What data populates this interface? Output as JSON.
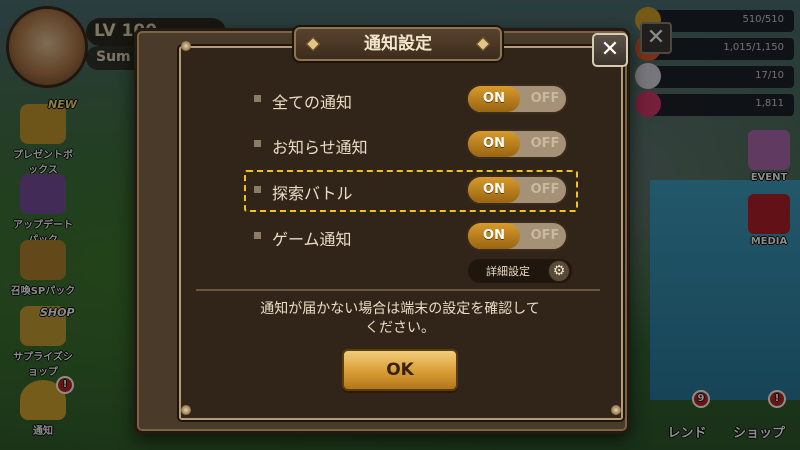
{
  "player": {
    "level_label": "LV 100",
    "name": "Sum"
  },
  "resources": [
    {
      "icon": "energy-icon",
      "value": "510/510",
      "color": "#d7a32a"
    },
    {
      "icon": "arena-wings-icon",
      "value": "1,015/1,150",
      "color": "#e05a2a"
    },
    {
      "icon": "wing-icon",
      "value": "17/10",
      "color": "#d9d9e0"
    },
    {
      "icon": "crystal-icon",
      "value": "1,811",
      "color": "#d63a6a"
    }
  ],
  "side_menu": [
    {
      "label": "プレゼントボックス",
      "tag": "NEW"
    },
    {
      "label": "アップデートパック",
      "tag": ""
    },
    {
      "label": "召喚SPパック",
      "tag": ""
    },
    {
      "label": "サプライズショップ",
      "tag": "SHOP"
    },
    {
      "label": "通知",
      "badge": "!"
    }
  ],
  "right_menu": [
    {
      "label": "EVENT"
    },
    {
      "label": "MEDIA"
    }
  ],
  "bottom_menu": [
    {
      "label": "レンド",
      "badge": "9"
    },
    {
      "label": "ショップ",
      "badge": "!"
    }
  ],
  "dialog": {
    "title": "通知設定",
    "close_glyph": "✕",
    "rows": [
      {
        "label": "全ての通知",
        "on_label": "ON",
        "off_label": "OFF",
        "state": "on"
      },
      {
        "label": "お知らせ通知",
        "on_label": "ON",
        "off_label": "OFF",
        "state": "on"
      },
      {
        "label": "探索バトル",
        "on_label": "ON",
        "off_label": "OFF",
        "state": "on",
        "highlighted": true
      },
      {
        "label": "ゲーム通知",
        "on_label": "ON",
        "off_label": "OFF",
        "state": "on"
      }
    ],
    "detail_label": "詳細設定",
    "message_line1": "通知が届かない場合は端末の設定を確認して",
    "message_line2": "ください。",
    "ok_label": "OK"
  },
  "colors": {
    "accent": "#f4c316",
    "toggle_on": "#c8891f",
    "panel": "#302518"
  }
}
